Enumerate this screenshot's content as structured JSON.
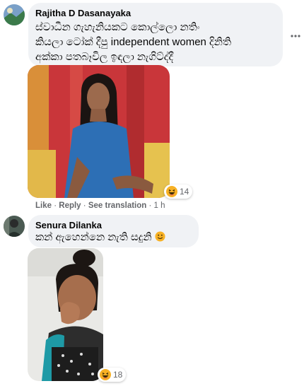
{
  "comment1": {
    "author": "Rajitha D Dasanayaka",
    "text_line1": "ස්වාධීන ගැහැනියකට කොල්ලො නතිං",
    "text_line2": "කියලා ටෝක් දීපු independent women දිනිති",
    "text_line3": "අක්කා පතබෑවිල ඉඳලා නැගිට්ද්දී",
    "reaction_count": "14",
    "actions": {
      "like": "Like",
      "reply": "Reply",
      "translate": "See translation",
      "time": "1 h",
      "sep": "·"
    },
    "more_icon": "more-horizontal-icon",
    "photo_desc_colors": {
      "dress": "#2c6fb3",
      "background": "#c9363a",
      "chair": "#e7c556"
    }
  },
  "comment2": {
    "author": "Senura Dilanka",
    "text": "කන් ඇහෙන්නෙ නැති සදුනි",
    "emoji": "smile-emoji",
    "reaction_count": "18"
  },
  "colors": {
    "bubble": "#f0f2f5",
    "meta": "#65676b",
    "reaction": "#f7b125"
  }
}
